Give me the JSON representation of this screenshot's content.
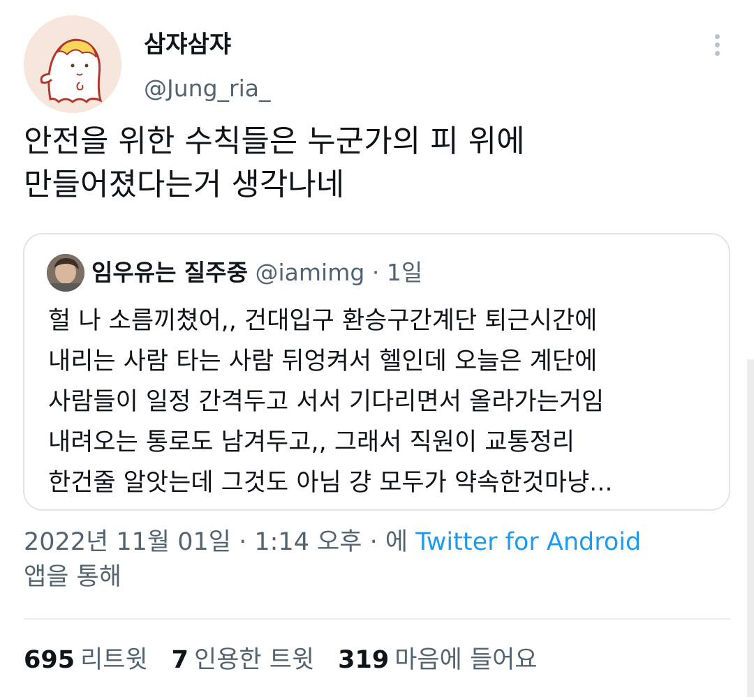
{
  "tweet": {
    "author_name": "삼쟈삼쟈",
    "author_handle": "@Jung_ria_",
    "text_lines": [
      "안전을 위한 수칙들은 누군가의 피 위에",
      "만들어졌다는거 생각나네"
    ],
    "more_icon": "more-vertical-icon"
  },
  "quote": {
    "author_name": "임우유는 질주중",
    "author_handle": "@iamimg",
    "separator": "·",
    "time": "1일",
    "body_lines": [
      "헐 나 소름끼쳤어,, 건대입구 환승구간계단 퇴근시간에",
      "내리는 사람 타는 사람 뒤엉켜서 헬인데 오늘은 계단에",
      "사람들이 일정 간격두고 서서 기다리면서 올라가는거임",
      "내려오는 통로도 남겨두고,, 그래서 직원이 교통정리",
      "한건줄 알앗는데 그것도 아님 걍 모두가 약속한것마냥..."
    ]
  },
  "meta": {
    "timestamp": "2022년 11월 01일 · 1:14 오후 · 에",
    "source": "Twitter for Android",
    "suffix": "앱을 통해"
  },
  "stats": {
    "retweets": "695",
    "retweets_label": "리트윗",
    "quotes": "7",
    "quotes_label": "인용한 트윗",
    "likes": "319",
    "likes_label": "마음에 들어요"
  },
  "colors": {
    "text": "#0f1419",
    "secondary": "#536471",
    "link": "#1d9bf0",
    "border": "#dfe5ea"
  }
}
